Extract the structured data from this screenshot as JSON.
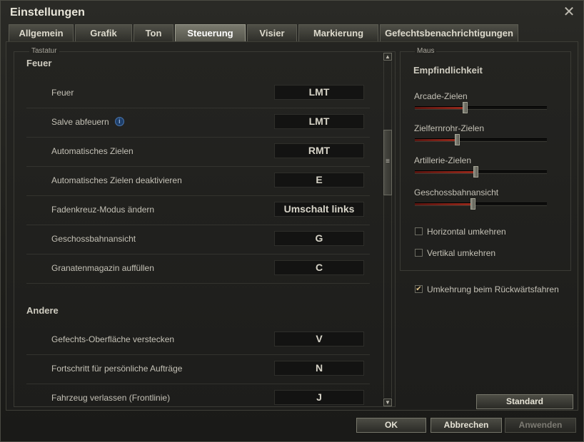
{
  "window": {
    "title": "Einstellungen"
  },
  "tabs": [
    {
      "label": "Allgemein"
    },
    {
      "label": "Grafik"
    },
    {
      "label": "Ton"
    },
    {
      "label": "Steuerung",
      "active": true
    },
    {
      "label": "Visier"
    },
    {
      "label": "Markierung"
    },
    {
      "label": "Gefechtsbenachrichtigungen"
    }
  ],
  "keyboard": {
    "legend": "Tastatur",
    "sections": [
      {
        "title": "Feuer",
        "rows": [
          {
            "label": "Feuer",
            "key": "LMT"
          },
          {
            "label": "Salve abfeuern",
            "key": "LMT",
            "info": "i"
          },
          {
            "label": "Automatisches Zielen",
            "key": "RMT"
          },
          {
            "label": "Automatisches Zielen deaktivieren",
            "key": "E"
          },
          {
            "label": "Fadenkreuz-Modus ändern",
            "key": "Umschalt links"
          },
          {
            "label": "Geschossbahnansicht",
            "key": "G"
          },
          {
            "label": "Granatenmagazin auffüllen",
            "key": "C"
          }
        ]
      },
      {
        "title": "Andere",
        "rows": [
          {
            "label": "Gefechts-Oberfläche verstecken",
            "key": "V"
          },
          {
            "label": "Fortschritt für persönliche Aufträge",
            "key": "N"
          },
          {
            "label": "Fahrzeug verlassen (Frontlinie)",
            "key": "J"
          }
        ]
      }
    ],
    "scroll": {
      "up": "▲",
      "down": "▼",
      "thumb": "≡"
    }
  },
  "mouse": {
    "legend": "Maus",
    "sensitivity_title": "Empfindlichkeit",
    "sliders": [
      {
        "label": "Arcade-Zielen",
        "value": 0.38
      },
      {
        "label": "Zielfernrohr-Zielen",
        "value": 0.32
      },
      {
        "label": "Artillerie-Zielen",
        "value": 0.46
      },
      {
        "label": "Geschossbahnansicht",
        "value": 0.44
      }
    ],
    "checkboxes": [
      {
        "label": "Horizontal umkehren",
        "checked": false
      },
      {
        "label": "Vertikal umkehren",
        "checked": false
      }
    ],
    "reverse_driving": {
      "label": "Umkehrung beim Rückwärtsfahren",
      "checked": true
    }
  },
  "buttons": {
    "standard": "Standard",
    "ok": "OK",
    "cancel": "Abbrechen",
    "apply": "Anwenden"
  },
  "icons": {
    "close": "✕",
    "check": "✔"
  },
  "colors": {
    "accent_red": "#9a2a1c",
    "check": "#e2c58a"
  }
}
